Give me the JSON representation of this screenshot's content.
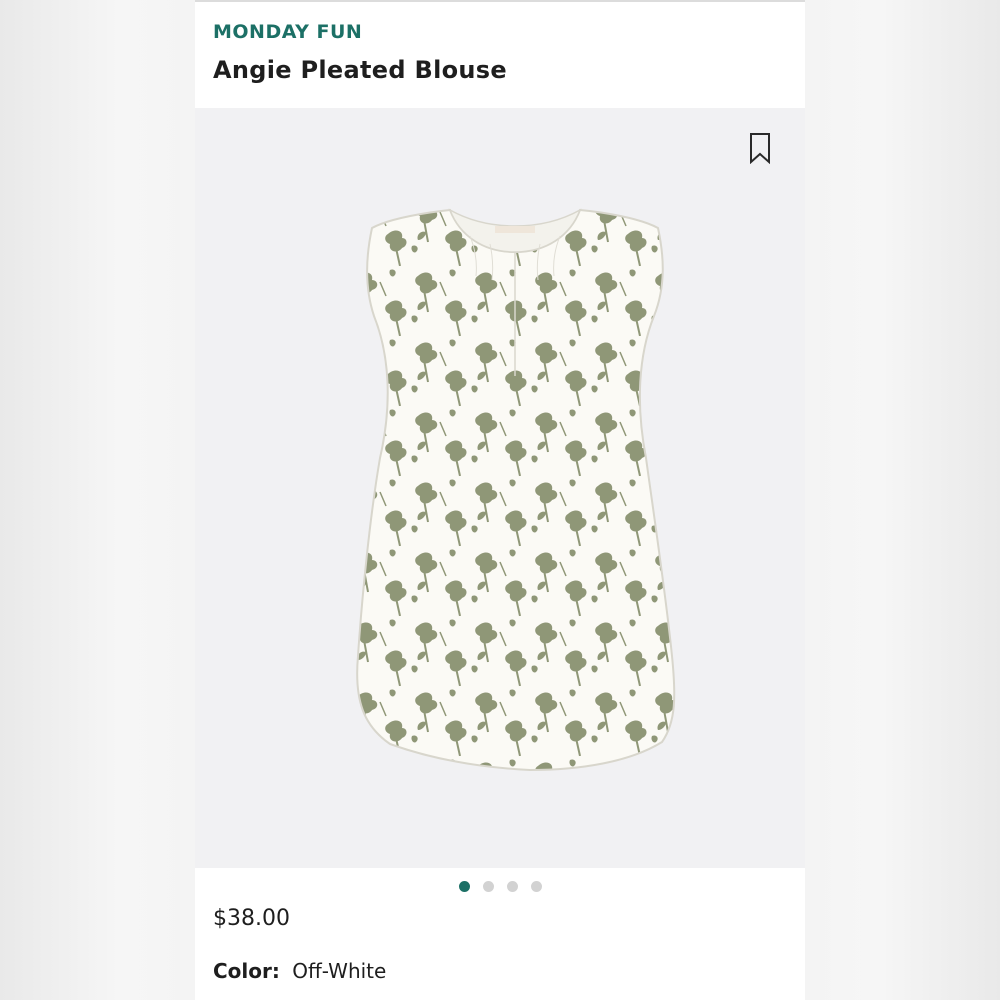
{
  "product": {
    "brand": "MONDAY FUN",
    "name": "Angie Pleated Blouse",
    "price": "$38.00",
    "color_label": "Color:",
    "color_value": "Off-White"
  },
  "gallery": {
    "image_count": 4,
    "active_index": 0
  },
  "icons": {
    "save": "bookmark-icon"
  },
  "colors": {
    "accent": "#1c7066",
    "print": "#8a9270",
    "fabric": "#fbfaf5",
    "background": "#f1f1f3",
    "dot_inactive": "#d2d2d2"
  }
}
